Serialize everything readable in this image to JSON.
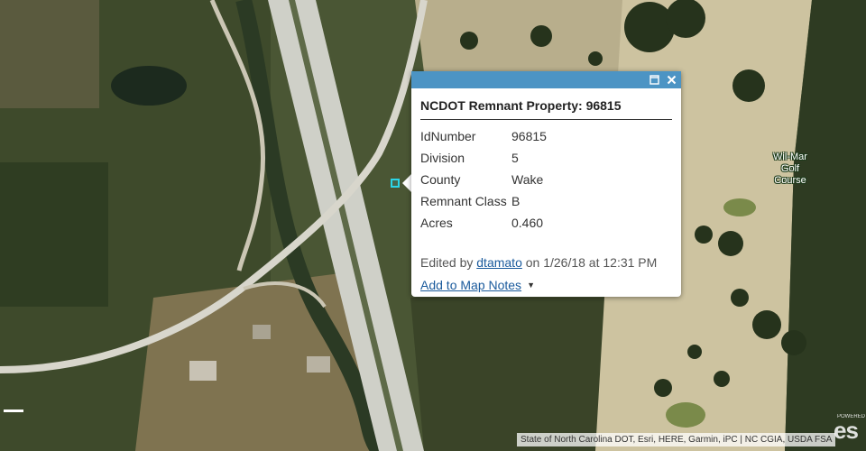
{
  "map": {
    "place_label": "Wil-Mar Golf Course",
    "attribution": "State of North Carolina DOT, Esri, HERE, Garmin, iPC | NC CGIA, USDA FSA",
    "logo_text": "es",
    "powered_text": "POWERED"
  },
  "popup": {
    "title": "NCDOT Remnant Property: 96815",
    "fields": [
      {
        "name": "IdNumber",
        "value": "96815"
      },
      {
        "name": "Division",
        "value": "5"
      },
      {
        "name": "County",
        "value": "Wake"
      },
      {
        "name": "Remnant Class",
        "value": "B"
      },
      {
        "name": "Acres",
        "value": "0.460"
      }
    ],
    "edited_prefix": "Edited by",
    "edited_user": "dtamato",
    "edited_suffix": "on 1/26/18 at 12:31 PM",
    "add_notes": "Add to Map Notes",
    "header_color": "#4c94c4"
  },
  "icons": {
    "maximize": "maximize-icon",
    "close": "close-icon",
    "dropdown": "caret-down-icon"
  }
}
